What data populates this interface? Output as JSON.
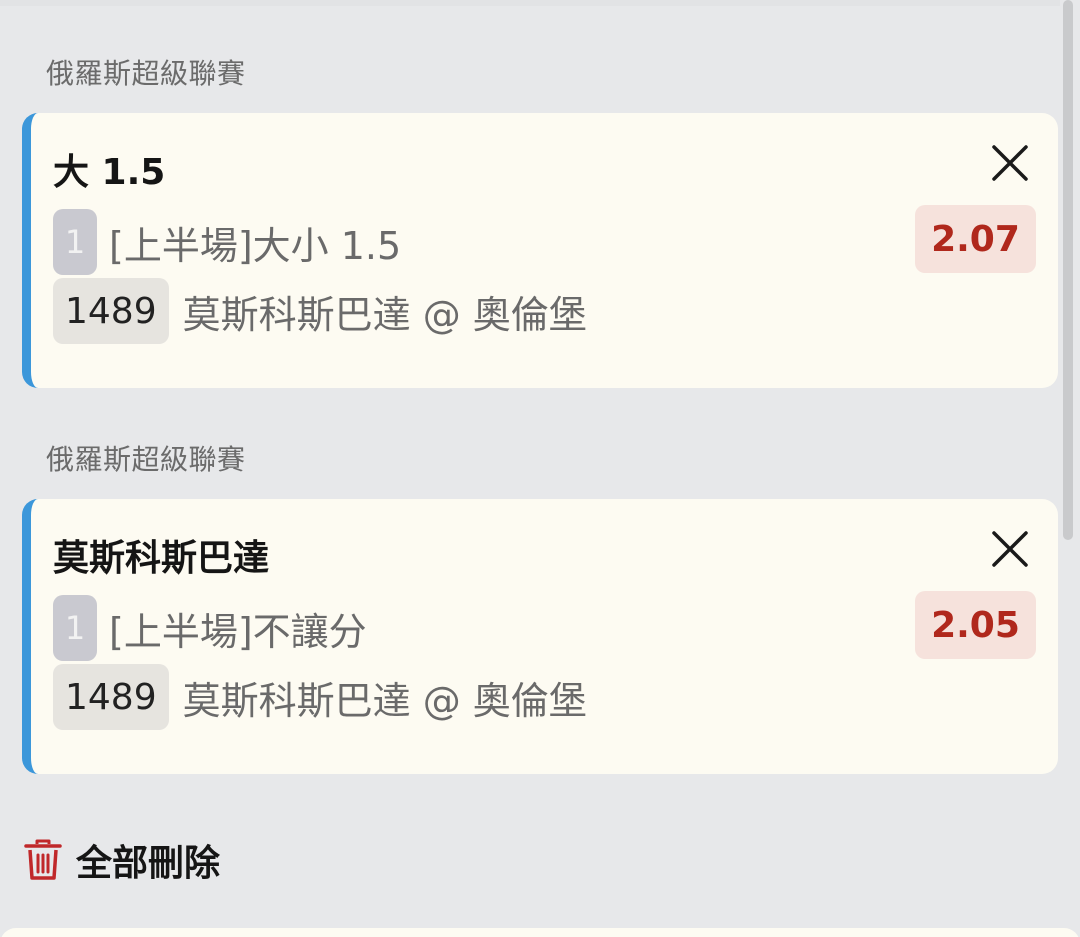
{
  "bets": [
    {
      "league": "俄羅斯超級聯賽",
      "selection": "大 1.5",
      "line_number": "1",
      "bet_type": "[上半場]大小 1.5",
      "odds": "2.07",
      "match_code": "1489",
      "match": "莫斯科斯巴達 @ 奧倫堡"
    },
    {
      "league": "俄羅斯超級聯賽",
      "selection": "莫斯科斯巴達",
      "line_number": "1",
      "bet_type": "[上半場]不讓分",
      "odds": "2.05",
      "match_code": "1489",
      "match": "莫斯科斯巴達 @ 奧倫堡"
    }
  ],
  "actions": {
    "delete_all_label": "全部刪除"
  },
  "colors": {
    "accent": "#3c97da",
    "odds_text": "#b0281c",
    "odds_bg": "#f6e2dc",
    "card_bg": "#fdfbf2",
    "page_bg": "#e7e8ea",
    "trash": "#c0282a"
  },
  "icons": {
    "close": "close-icon",
    "delete": "trash-icon"
  }
}
